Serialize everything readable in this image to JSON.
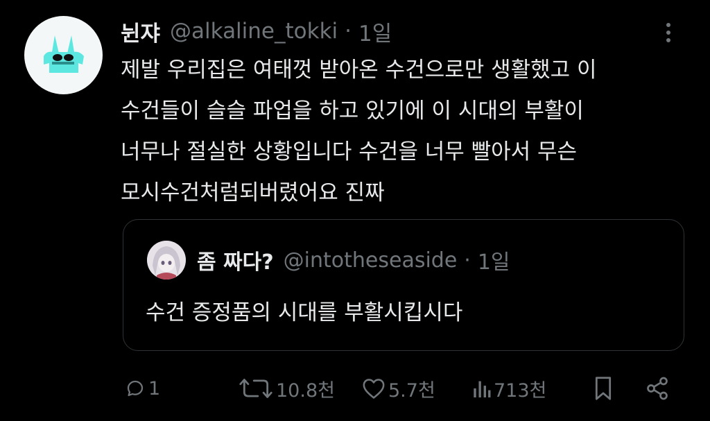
{
  "tweet": {
    "display_name": "뉜쟈",
    "handle": "@alkaline_tokki",
    "separator": "·",
    "time": "1일",
    "lines": [
      "제발 우리집은 여태껏 받아온 수건으로만 생활했고 이",
      "수건들이 슬슬 파업을 하고 있기에 이 시대의 부활이",
      "너무나 절실한 상황입니다 수건을 너무 빨아서 무슨",
      "모시수건처럼되버렸어요 진짜"
    ]
  },
  "quoted": {
    "display_name": "좀 짜다?",
    "handle": "@intotheseaside",
    "separator": "·",
    "time": "1일",
    "text": "수건 증정품의 시대를 부활시킵시다"
  },
  "actions": {
    "reply_count": "1",
    "retweet_count": "10.8천",
    "like_count": "5.7천",
    "view_count": "713천"
  },
  "colors": {
    "background": "#000000",
    "text": "#e7e9ea",
    "muted": "#71767b",
    "border": "#2f3336",
    "avatar_accent": "#5ce8e0"
  }
}
